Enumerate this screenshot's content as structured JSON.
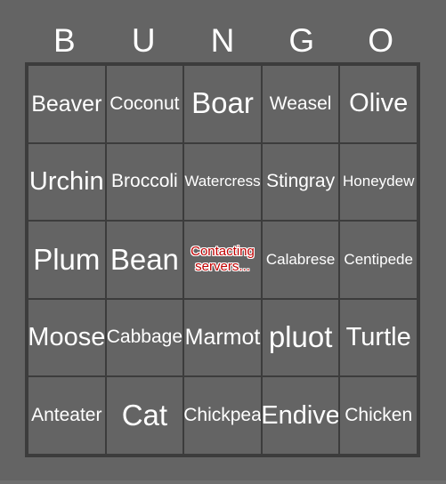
{
  "card": {
    "header_letters": [
      "B",
      "U",
      "N",
      "G",
      "O"
    ],
    "colors": {
      "background": "#646464",
      "cell_background": "#646464",
      "border": "#3c3c3c",
      "text": "#ffffff",
      "status_text": "#c00000",
      "status_outline": "#ffffff",
      "bottom_strip": "#6e6e6e"
    },
    "rows": [
      [
        {
          "label": "Beaver",
          "size": "l",
          "status": false
        },
        {
          "label": "Coconut",
          "size": "m",
          "status": false
        },
        {
          "label": "Boar",
          "size": "xxl",
          "status": false
        },
        {
          "label": "Weasel",
          "size": "m",
          "status": false
        },
        {
          "label": "Olive",
          "size": "xl",
          "status": false
        }
      ],
      [
        {
          "label": "Urchin",
          "size": "xl",
          "status": false
        },
        {
          "label": "Broccoli",
          "size": "m",
          "status": false
        },
        {
          "label": "Watercress",
          "size": "s",
          "status": false
        },
        {
          "label": "Stingray",
          "size": "m",
          "status": false
        },
        {
          "label": "Honeydew",
          "size": "s",
          "status": false
        }
      ],
      [
        {
          "label": "Plum",
          "size": "xxl",
          "status": false
        },
        {
          "label": "Bean",
          "size": "xxl",
          "status": false
        },
        {
          "label": "Contacting servers...",
          "size": "xs",
          "status": true
        },
        {
          "label": "Calabrese",
          "size": "s",
          "status": false
        },
        {
          "label": "Centipede",
          "size": "s",
          "status": false
        }
      ],
      [
        {
          "label": "Moose",
          "size": "xl",
          "status": false
        },
        {
          "label": "Cabbage",
          "size": "m",
          "status": false
        },
        {
          "label": "Marmot",
          "size": "l",
          "status": false
        },
        {
          "label": "pluot",
          "size": "xxl",
          "status": false
        },
        {
          "label": "Turtle",
          "size": "xl",
          "status": false
        }
      ],
      [
        {
          "label": "Anteater",
          "size": "m",
          "status": false
        },
        {
          "label": "Cat",
          "size": "xxl",
          "status": false
        },
        {
          "label": "Chickpea",
          "size": "m",
          "status": false
        },
        {
          "label": "Endive",
          "size": "xl",
          "status": false
        },
        {
          "label": "Chicken",
          "size": "m",
          "status": false
        }
      ]
    ]
  }
}
